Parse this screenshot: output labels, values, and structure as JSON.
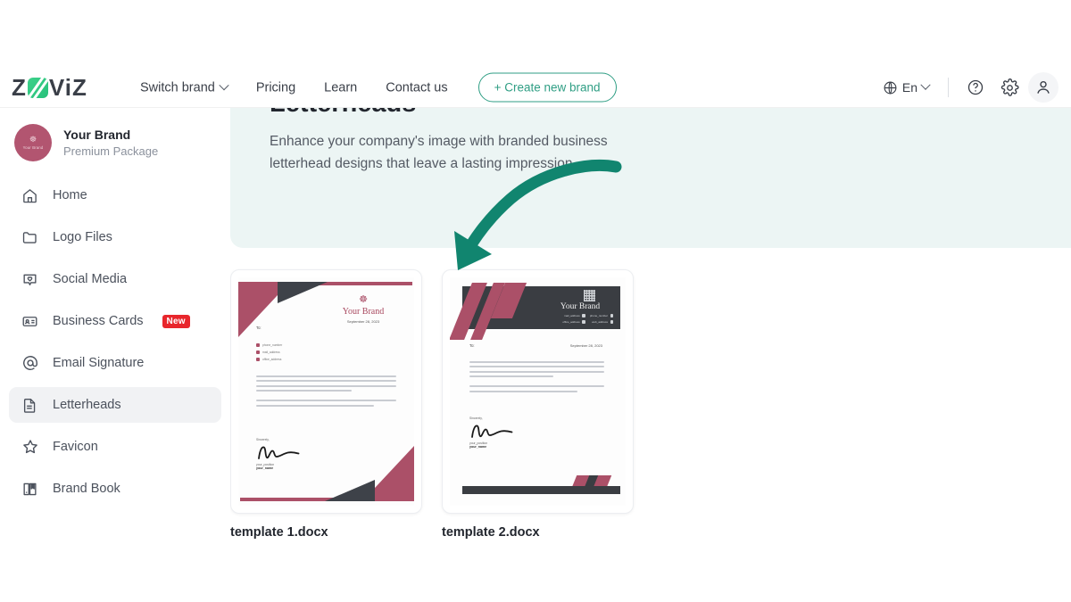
{
  "header": {
    "logo_text_left": "Z",
    "logo_text_right": "ViZ",
    "logo_mark_name": "zoviz-logo-mark",
    "nav": [
      {
        "label": "Switch brand",
        "has_caret": true
      },
      {
        "label": "Pricing",
        "has_caret": false
      },
      {
        "label": "Learn",
        "has_caret": false
      },
      {
        "label": "Contact us",
        "has_caret": false
      }
    ],
    "create_brand_label": "+ Create new brand",
    "language": "En",
    "icons": {
      "globe": "globe-icon",
      "help": "help-circle-icon",
      "settings": "gear-icon",
      "account": "user-avatar-icon"
    }
  },
  "sidebar": {
    "brand": {
      "name": "Your Brand",
      "package": "Premium Package",
      "avatar_text": "Your Brand",
      "avatar_color": "#b25570"
    },
    "items": [
      {
        "label": "Home",
        "icon": "home-icon",
        "active": false,
        "badge": ""
      },
      {
        "label": "Logo Files",
        "icon": "folder-icon",
        "active": false,
        "badge": ""
      },
      {
        "label": "Social Media",
        "icon": "heart-chat-icon",
        "active": false,
        "badge": ""
      },
      {
        "label": "Business Cards",
        "icon": "id-card-icon",
        "active": false,
        "badge": "New"
      },
      {
        "label": "Email Signature",
        "icon": "at-sign-icon",
        "active": false,
        "badge": ""
      },
      {
        "label": "Letterheads",
        "icon": "document-icon",
        "active": true,
        "badge": ""
      },
      {
        "label": "Favicon",
        "icon": "star-icon",
        "active": false,
        "badge": ""
      },
      {
        "label": "Brand Book",
        "icon": "book-icon",
        "active": false,
        "badge": ""
      }
    ]
  },
  "main": {
    "hero": {
      "title": "Letterheads",
      "subtitle": "Enhance your company's image with branded business letterhead designs that leave a lasting impression.",
      "background": "#ecf5f4"
    },
    "templates": [
      {
        "filename": "template 1.docx",
        "to_label": "To:",
        "date": "September 28, 2023",
        "brand_name": "Your Brand",
        "contacts": [
          "phone_number",
          "mail_address",
          "office_address"
        ],
        "closing": "Sincerely,",
        "signer_role": "your_position",
        "signer_name": "your_name",
        "accent_color": "#ab5068",
        "dark_color": "#3e4249"
      },
      {
        "filename": "template 2.docx",
        "to_label": "To:",
        "date": "September 28, 2023",
        "brand_name": "Your Brand",
        "contacts": [
          "mail_address",
          "office_address",
          "phone_number",
          "web_address"
        ],
        "closing": "Sincerely,",
        "signer_role": "your_position",
        "signer_name": "your_name",
        "accent_color": "#ab5068",
        "dark_color": "#3a3d42"
      }
    ],
    "annotation": {
      "type": "curved-arrow",
      "color": "#11856f",
      "points_to": "template 2.docx"
    }
  }
}
